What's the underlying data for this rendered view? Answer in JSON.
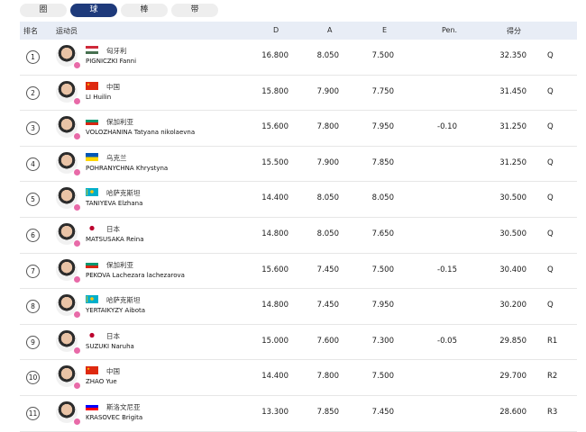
{
  "tabs": [
    {
      "label": "圈",
      "active": false
    },
    {
      "label": "球",
      "active": true
    },
    {
      "label": "棒",
      "active": false
    },
    {
      "label": "带",
      "active": false
    }
  ],
  "headers": {
    "rank": "排名",
    "athlete": "运动员",
    "d": "D",
    "a": "A",
    "e": "E",
    "pen": "Pen.",
    "score": "得分"
  },
  "flags": {
    "HUN": {
      "type": "h3",
      "colors": [
        "#ce2939",
        "#ffffff",
        "#477050"
      ]
    },
    "CHN": {
      "type": "chn",
      "colors": [
        "#de2910",
        "#ffde00"
      ]
    },
    "BUL": {
      "type": "h3",
      "colors": [
        "#ffffff",
        "#00966e",
        "#d62612"
      ]
    },
    "UKR": {
      "type": "h2",
      "colors": [
        "#0057b7",
        "#ffd700"
      ]
    },
    "KAZ": {
      "type": "kaz",
      "colors": [
        "#00afca",
        "#fec50c"
      ]
    },
    "JPN": {
      "type": "jpn",
      "colors": [
        "#ffffff",
        "#bc002d"
      ]
    },
    "SLO": {
      "type": "h3",
      "colors": [
        "#ffffff",
        "#0000ff",
        "#ff0000"
      ]
    }
  },
  "rows": [
    {
      "rank": "1",
      "country": "匈牙利",
      "flag": "HUN",
      "name": "PIGNICZKI Fanni",
      "d": "16.800",
      "a": "8.050",
      "e": "7.500",
      "pen": "",
      "score": "32.350",
      "q": "Q"
    },
    {
      "rank": "2",
      "country": "中国",
      "flag": "CHN",
      "name": "LI Huilin",
      "d": "15.800",
      "a": "7.900",
      "e": "7.750",
      "pen": "",
      "score": "31.450",
      "q": "Q"
    },
    {
      "rank": "3",
      "country": "保加利亚",
      "flag": "BUL",
      "name": "VOLOZHANINA Tatyana nikolaevna",
      "d": "15.600",
      "a": "7.800",
      "e": "7.950",
      "pen": "-0.10",
      "score": "31.250",
      "q": "Q"
    },
    {
      "rank": "4",
      "country": "乌克兰",
      "flag": "UKR",
      "name": "POHRANYCHNA Khrystyna",
      "d": "15.500",
      "a": "7.900",
      "e": "7.850",
      "pen": "",
      "score": "31.250",
      "q": "Q"
    },
    {
      "rank": "5",
      "country": "哈萨克斯坦",
      "flag": "KAZ",
      "name": "TANIYEVA Elzhana",
      "d": "14.400",
      "a": "8.050",
      "e": "8.050",
      "pen": "",
      "score": "30.500",
      "q": "Q"
    },
    {
      "rank": "6",
      "country": "日本",
      "flag": "JPN",
      "name": "MATSUSAKA Reina",
      "d": "14.800",
      "a": "8.050",
      "e": "7.650",
      "pen": "",
      "score": "30.500",
      "q": "Q"
    },
    {
      "rank": "7",
      "country": "保加利亚",
      "flag": "BUL",
      "name": "PEKOVA Lachezara lachezarova",
      "d": "15.600",
      "a": "7.450",
      "e": "7.500",
      "pen": "-0.15",
      "score": "30.400",
      "q": "Q"
    },
    {
      "rank": "8",
      "country": "哈萨克斯坦",
      "flag": "KAZ",
      "name": "YERTAIKYZY Aibota",
      "d": "14.800",
      "a": "7.450",
      "e": "7.950",
      "pen": "",
      "score": "30.200",
      "q": "Q"
    },
    {
      "rank": "9",
      "country": "日本",
      "flag": "JPN",
      "name": "SUZUKI Naruha",
      "d": "15.000",
      "a": "7.600",
      "e": "7.300",
      "pen": "-0.05",
      "score": "29.850",
      "q": "R1"
    },
    {
      "rank": "10",
      "country": "中国",
      "flag": "CHN",
      "name": "ZHAO Yue",
      "d": "14.400",
      "a": "7.800",
      "e": "7.500",
      "pen": "",
      "score": "29.700",
      "q": "R2"
    },
    {
      "rank": "11",
      "country": "斯洛文尼亚",
      "flag": "SLO",
      "name": "KRASOVEC Brigita",
      "d": "13.300",
      "a": "7.850",
      "e": "7.450",
      "pen": "",
      "score": "28.600",
      "q": "R3"
    }
  ]
}
